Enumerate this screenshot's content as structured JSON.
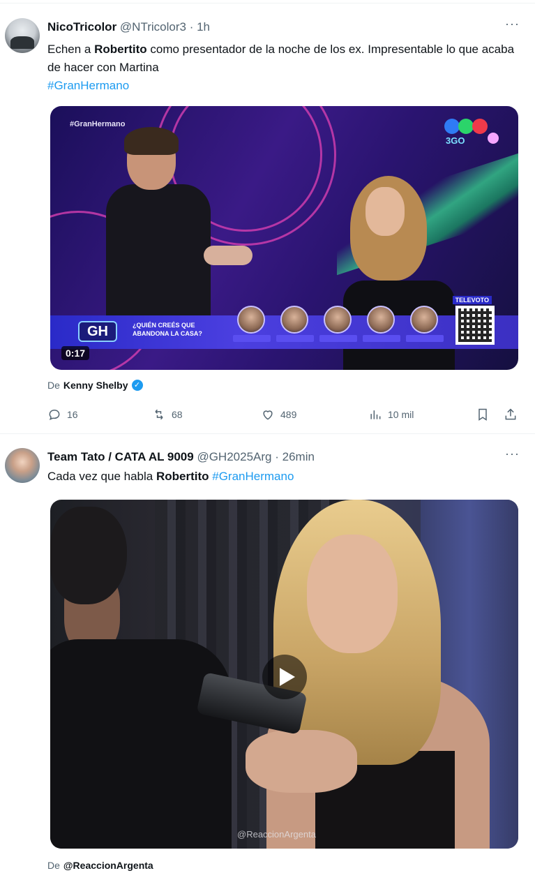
{
  "tweets": [
    {
      "display_name": "NicoTricolor",
      "handle": "@NTricolor3",
      "separator": "·",
      "time": "1h",
      "more": "···",
      "text_a": "Echen a ",
      "text_bold": "Robertito",
      "text_b": " como presentador de la noche de los ex. Impresentable lo que acaba de hacer con Martina",
      "hashtag": "#GranHermano",
      "media": {
        "channel_tag": "#GranHermano",
        "channel_sub": "3GO",
        "gh_logo": "GH",
        "question": "¿QUIÉN CREÉS QUE ABANDONA LA CASA?",
        "qr_label": "TELEVOTO",
        "duration": "0:17",
        "colors": {
          "bar": "#2a2ac8",
          "accent_pink": "#d63fb0",
          "accent_green": "#35c98a"
        }
      },
      "attribution_prefix": "De",
      "attribution_name": "Kenny Shelby",
      "verified": "✓",
      "stats": {
        "replies": "16",
        "reposts": "68",
        "likes": "489",
        "views": "10 mil"
      }
    },
    {
      "display_name": "Team Tato / CATA AL 9009",
      "handle": "@GH2025Arg",
      "separator": "·",
      "time": "26min",
      "more": "···",
      "text_a": "Cada vez que habla ",
      "text_bold": "Robertito",
      "text_b": " ",
      "hashtag": "#GranHermano",
      "media": {
        "watermark": "@ReaccionArgenta"
      },
      "attribution_prefix": "De",
      "attribution_name": "@ReaccionArgenta"
    }
  ],
  "icons": {
    "reply": "reply-icon",
    "repost": "repost-icon",
    "like": "heart-icon",
    "views": "views-icon",
    "bookmark": "bookmark-icon",
    "share": "share-icon"
  },
  "colors": {
    "link": "#1d9bf0",
    "secondary": "#536471",
    "text": "#0f1419"
  }
}
